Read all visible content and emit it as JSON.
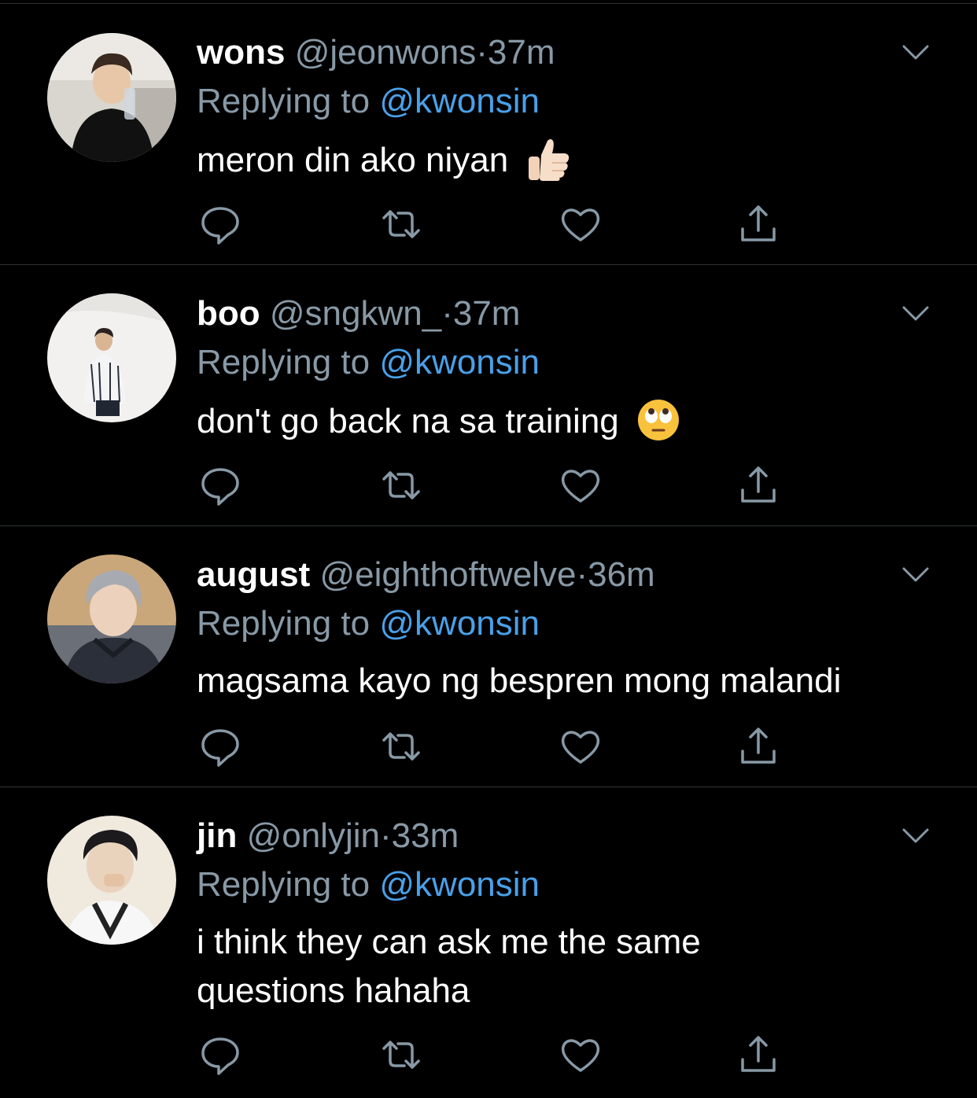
{
  "colors": {
    "background": "#000000",
    "primary_text": "#ffffff",
    "secondary_text": "#8899a6",
    "mention": "#4aa0e8",
    "divider": "#2f3336"
  },
  "icons": {
    "caret": "chevron-down-icon",
    "reply": "reply-icon",
    "retweet": "retweet-icon",
    "like": "heart-icon",
    "share": "share-icon"
  },
  "tweets": [
    {
      "display_name": "wons",
      "handle": "@jeonwons",
      "separator": "·",
      "time": "37m",
      "replying_prefix": "Replying to",
      "replying_to": "@kwonsin",
      "text": "meron din ako niyan",
      "emoji": "thumbs-up-emoji"
    },
    {
      "display_name": "boo",
      "handle": "@sngkwn_",
      "separator": "·",
      "time": "37m",
      "replying_prefix": "Replying to",
      "replying_to": "@kwonsin",
      "text": "don't go back na sa training",
      "emoji": "eye-roll-emoji"
    },
    {
      "display_name": "august",
      "handle": "@eighthoftwelve",
      "separator": "·",
      "time": "36m",
      "replying_prefix": "Replying to",
      "replying_to": "@kwonsin",
      "text": "magsama kayo ng bespren mong malandi",
      "emoji": ""
    },
    {
      "display_name": "jin",
      "handle": "@onlyjin",
      "separator": "·",
      "time": "33m",
      "replying_prefix": "Replying to",
      "replying_to": "@kwonsin",
      "text_lines": [
        "i think they can ask me the same",
        "questions hahaha"
      ],
      "emoji": ""
    }
  ]
}
